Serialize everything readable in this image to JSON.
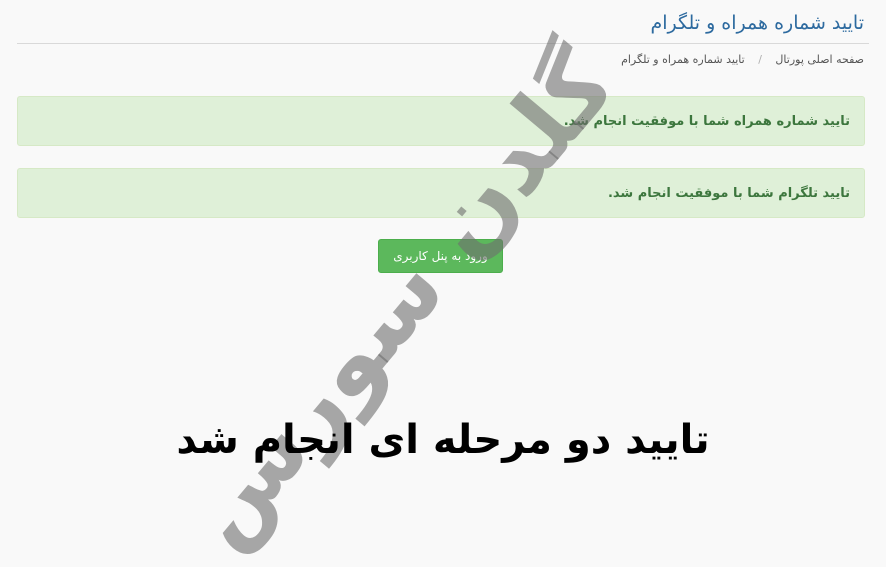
{
  "page": {
    "title": "تایید شماره همراه و تلگرام"
  },
  "breadcrumb": {
    "home": "صفحه اصلی پورتال",
    "separator": "/",
    "current": "تایید شماره همراه و تلگرام"
  },
  "alerts": {
    "phone": "تایید شماره همراه شما با موفقیت انجام شد.",
    "telegram": "تایید تلگرام شما با موفقیت انجام شد."
  },
  "actions": {
    "user_panel_label": "ورود به پنل کاربری"
  },
  "overlay": {
    "watermark": "گلدن سورس",
    "caption": "تایید دو مرحله ای انجام شد"
  },
  "colors": {
    "title": "#2d6a9f",
    "alert_background": "#dff0d8",
    "alert_text": "#3c763d",
    "button": "#5cb85c"
  }
}
